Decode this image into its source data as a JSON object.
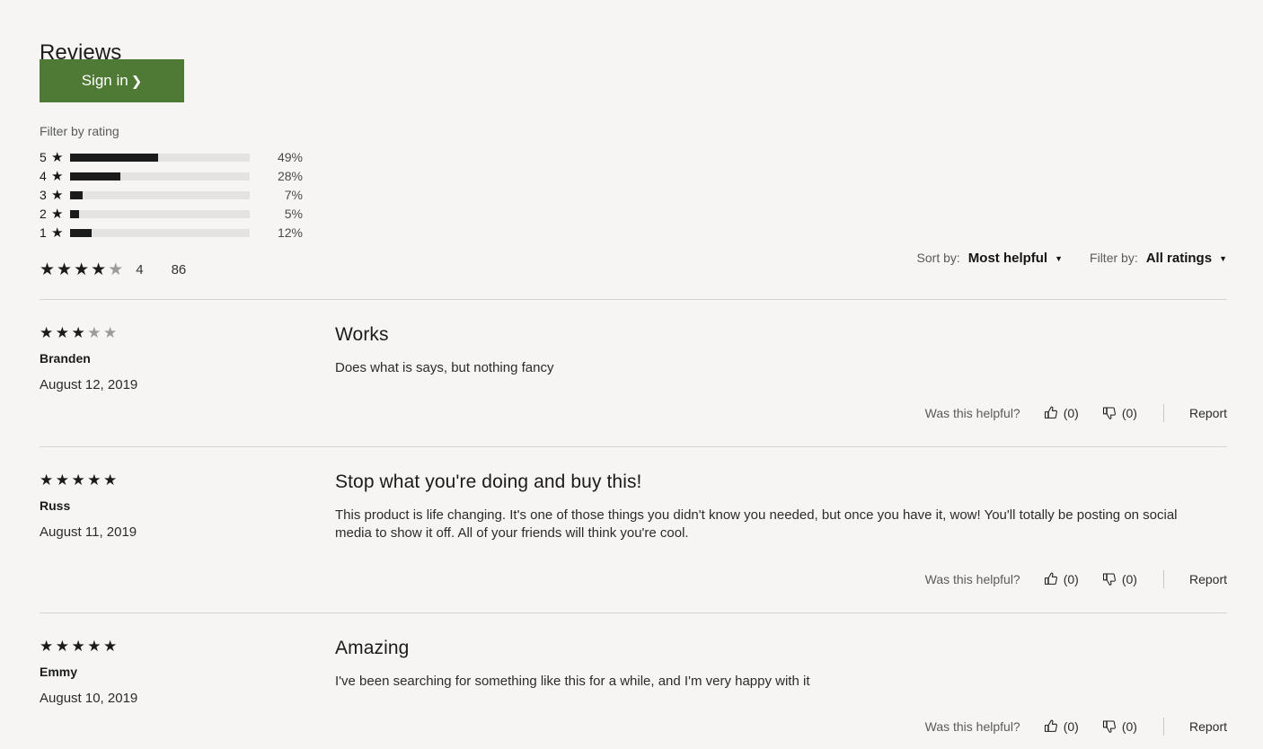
{
  "header": {
    "title": "Reviews",
    "sign_in_label": "Sign in",
    "sign_in_chevron": "chevron-right-icon"
  },
  "rating_filter": {
    "label": "Filter by rating",
    "rows": [
      {
        "stars": "5",
        "star_glyph": "★",
        "percent_label": "49%",
        "percent_value": 49
      },
      {
        "stars": "4",
        "star_glyph": "★",
        "percent_label": "28%",
        "percent_value": 28
      },
      {
        "stars": "3",
        "star_glyph": "★",
        "percent_label": "7%",
        "percent_value": 7
      },
      {
        "stars": "2",
        "star_glyph": "★",
        "percent_label": "5%",
        "percent_value": 5
      },
      {
        "stars": "1",
        "star_glyph": "★",
        "percent_label": "12%",
        "percent_value": 12
      }
    ]
  },
  "summary": {
    "filled_stars": 4,
    "total_stars": 5,
    "average_label": "4",
    "review_count_label": "86"
  },
  "controls": {
    "sort": {
      "label": "Sort by:",
      "value": "Most helpful",
      "caret": "chevron-down-icon"
    },
    "filter": {
      "label": "Filter by:",
      "value": "All ratings",
      "caret": "chevron-down-icon"
    }
  },
  "helpful": {
    "prompt": "Was this helpful?",
    "thumbs_up_icon": "thumbs-up-icon",
    "thumbs_down_icon": "thumbs-down-icon",
    "report_label": "Report"
  },
  "reviews": [
    {
      "rating": 3,
      "author": "Branden",
      "date": "August 12, 2019",
      "title": "Works",
      "body": "Does what is says, but nothing fancy",
      "helpful_yes": "(0)",
      "helpful_no": "(0)"
    },
    {
      "rating": 5,
      "author": "Russ",
      "date": "August 11, 2019",
      "title": "Stop what you're doing and buy this!",
      "body": "This product is life changing. It's one of those things you didn't know you needed, but once you have it, wow! You'll totally be posting on social media to show it off. All of your friends will think you're cool.",
      "helpful_yes": "(0)",
      "helpful_no": "(0)"
    },
    {
      "rating": 5,
      "author": "Emmy",
      "date": "August 10, 2019",
      "title": "Amazing",
      "body": "I've been searching for something like this for a while, and I'm very happy with it",
      "helpful_yes": "(0)",
      "helpful_no": "(0)"
    }
  ],
  "colors": {
    "background": "#f6f5f3",
    "accent_green": "#4f7a35",
    "bar_fill": "#1b1b1b",
    "bar_track": "#e4e3e1",
    "divider": "#d6d4d1",
    "star_on": "#1b1b1b",
    "star_off": "#9b9b9b"
  }
}
